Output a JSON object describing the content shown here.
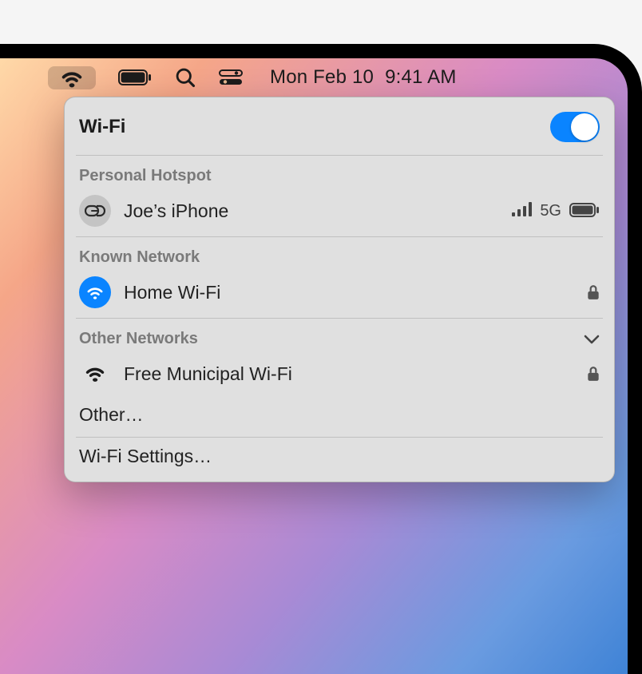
{
  "menubar": {
    "date": "Mon Feb 10",
    "time": "9:41 AM"
  },
  "dropdown": {
    "title": "Wi-Fi",
    "toggle_on": true,
    "hotspot": {
      "section_label": "Personal Hotspot",
      "name": "Joe’s iPhone",
      "signal_tag": "5G"
    },
    "known": {
      "section_label": "Known Network",
      "name": "Home Wi-Fi"
    },
    "other": {
      "section_label": "Other Networks",
      "items": [
        {
          "name": "Free Municipal Wi-Fi",
          "locked": true
        }
      ],
      "other_label": "Other…"
    },
    "settings_label": "Wi-Fi Settings…"
  }
}
